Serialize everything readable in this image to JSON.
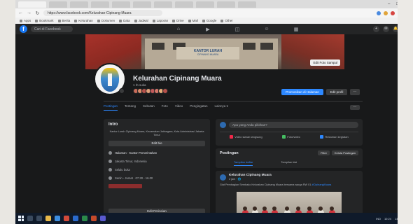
{
  "browser": {
    "tabs": [
      "",
      "",
      "",
      "",
      "",
      "",
      "",
      "",
      "",
      "",
      ""
    ],
    "url": "https://www.facebook.com/Kelurahan-Cipinang-Muara",
    "window_controls": [
      "–",
      "□",
      "✕"
    ],
    "bookmarks": [
      "Apps",
      "Bookmark",
      "Berita",
      "Kelurahan",
      "Dokumen",
      "Data",
      "Jadwal",
      "Laporan",
      "Drive",
      "Mail",
      "Google",
      "Other"
    ]
  },
  "facebook": {
    "logo": "f",
    "search_placeholder": "Cari di Facebook",
    "nav_icons": [
      "⌂",
      "▶",
      "◫",
      "☺",
      "▦"
    ],
    "right_icons": [
      "+",
      "✉",
      "🔔",
      "▾"
    ]
  },
  "cover": {
    "sign_title": "KANTOR LURAH",
    "sign_subtitle": "CIPINANG MUARA",
    "edit_button": "Edit Foto Sampul"
  },
  "page": {
    "name": "Kelurahan Cipinang Muara",
    "likes": "1 rb suka",
    "promote_button": "Promosikan di Halaman",
    "edit_button": "Edit profil",
    "more_button": "···"
  },
  "tabs": {
    "items": [
      "Postingan",
      "Tentang",
      "Sebutan",
      "Foto",
      "Video",
      "Pengingatan",
      "Lainnya ▾"
    ],
    "more": "···"
  },
  "intro": {
    "title": "Intro",
    "description": "Kantor Lurah Cipinang Muara, Kecamatan Jatinegara, Kota Administrasi Jakarta Timur",
    "edit_bio": "Edit bio",
    "lines": [
      "Halaman · Kantor Pemerintahan",
      "Jakarta Timur, Indonesia",
      "Selalu buka",
      "Senin - Jumat · 07.30 - 16.00"
    ],
    "edit_details": "Edit Perincian"
  },
  "composer": {
    "placeholder": "Apa yang Anda pikirkan?",
    "actions": [
      "Video siaran langsung",
      "Foto/video",
      "Rekaman kegiatan"
    ]
  },
  "posts": {
    "title": "Postingan",
    "filter_button": "Filter",
    "manage_button": "Kelola Postingan",
    "view_list": "Tampilan daftar",
    "view_grid": "Tampilan kisi"
  },
  "post": {
    "author": "Kelurahan Cipinang Muara",
    "time": "2 jam · 🌐",
    "text": "Giat Pembagian Sembako Kelurahan Cipinang Muara bersama warga RW 01",
    "tag": "#CipinangMuara"
  },
  "taskbar": {
    "time": "10:24",
    "date": "14/10/2021",
    "lang": "IND"
  },
  "colors": {
    "fb_blue": "#2d88ff",
    "dark_bg": "#18191a",
    "card_bg": "#242526"
  }
}
